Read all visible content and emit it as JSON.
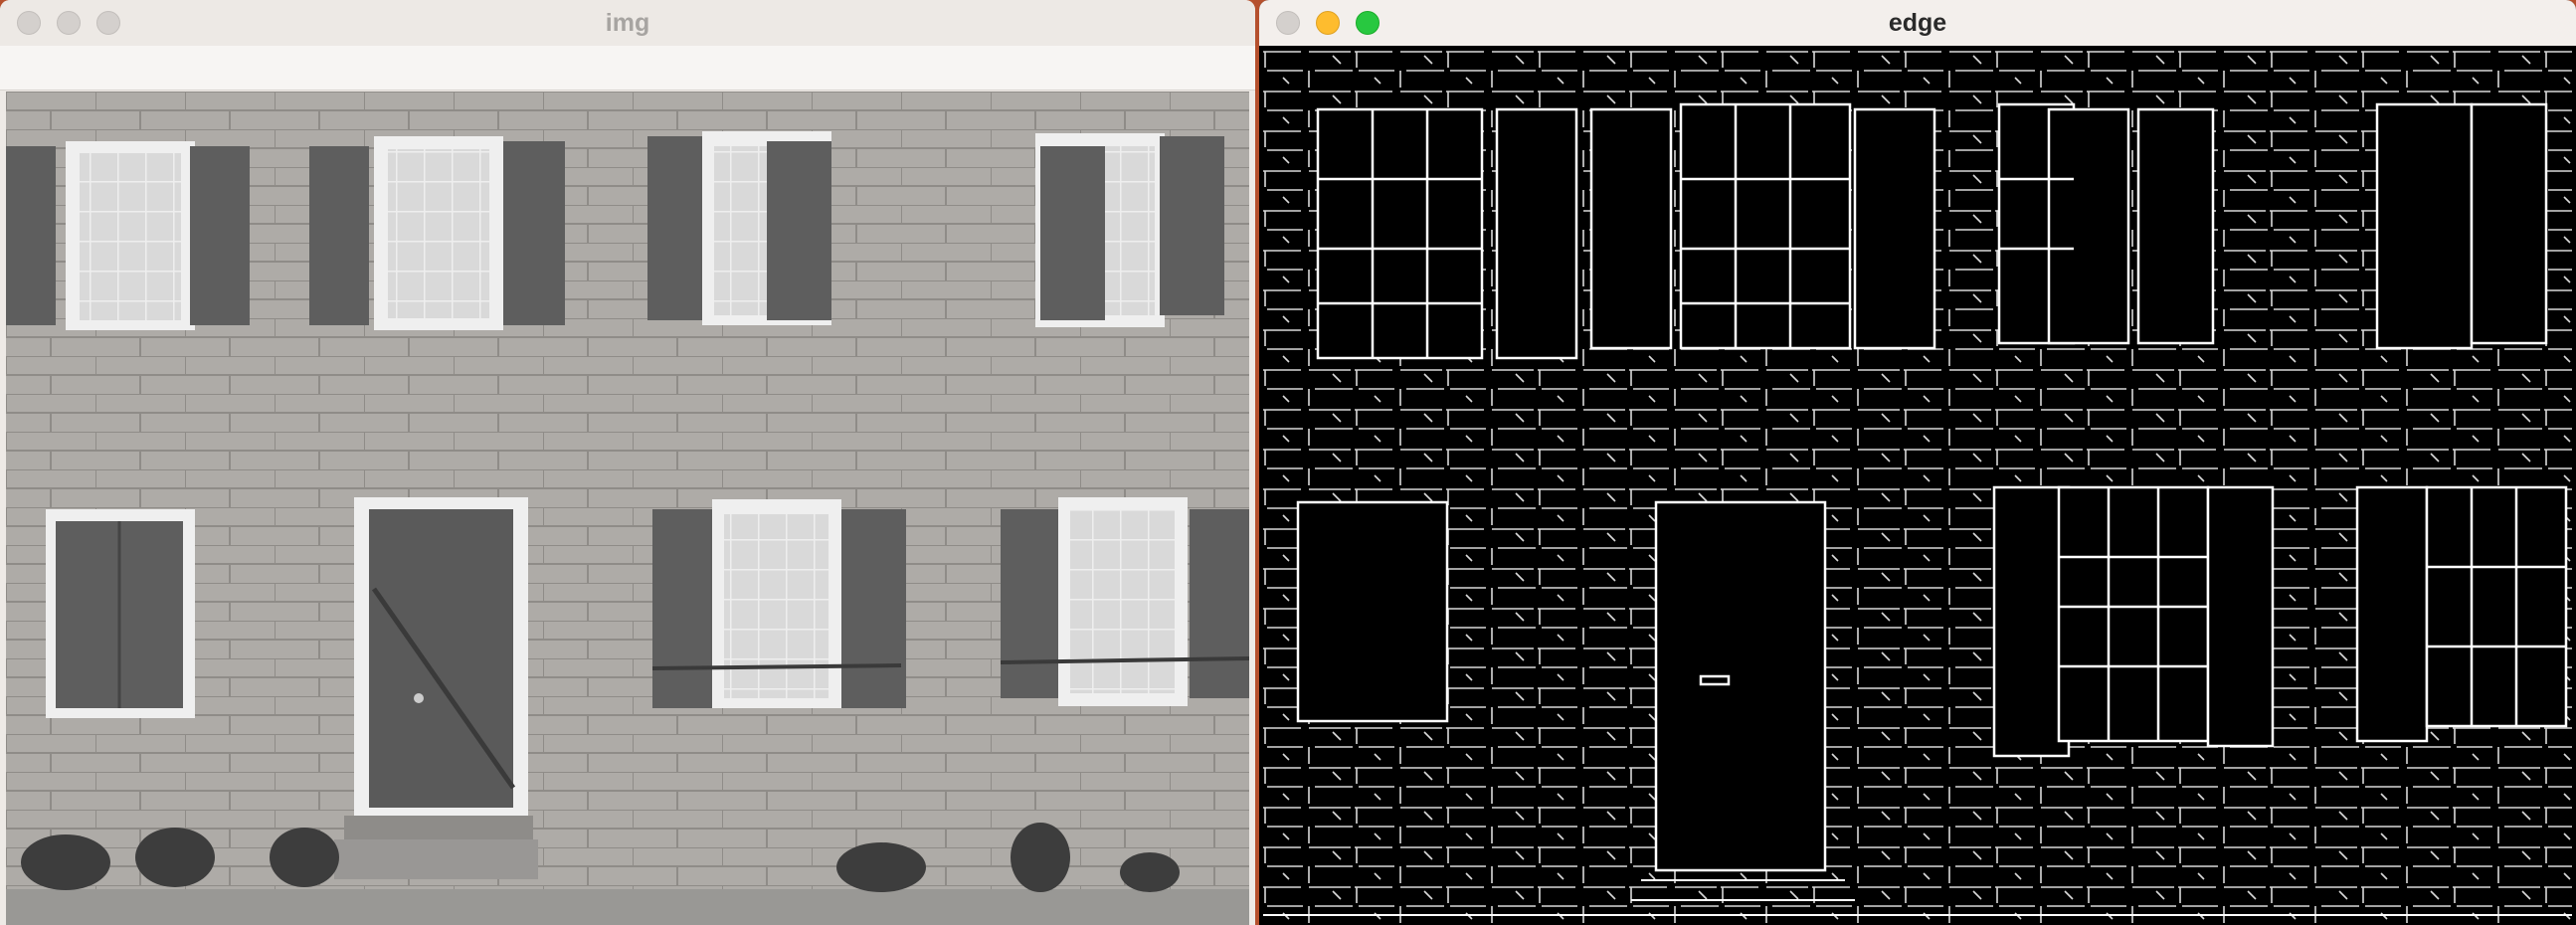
{
  "windows": {
    "img": {
      "title": "img"
    },
    "edge": {
      "title": "edge"
    }
  },
  "colors": {
    "desktop": "#b5502d",
    "wall": "#a9a6a2",
    "shutter": "#5c5c5c",
    "edge_line": "#ffffff"
  },
  "icons": {
    "close": "close-icon",
    "minimize": "minimize-icon",
    "maximize": "maximize-icon"
  }
}
